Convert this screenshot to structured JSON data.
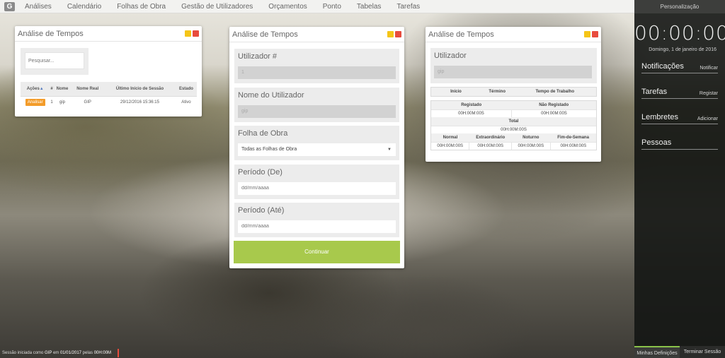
{
  "nav": {
    "logo": "G",
    "items": [
      "Análises",
      "Calendário",
      "Folhas de Obra",
      "Gestão de Utilizadores",
      "Orçamentos",
      "Ponto",
      "Tabelas",
      "Tarefas"
    ]
  },
  "sidebar": {
    "header": "Personalização",
    "clock": "00:00:00",
    "date": "Domingo, 1 de janeiro de 2016",
    "sections": [
      {
        "title": "Notificações",
        "action": "Notificar"
      },
      {
        "title": "Tarefas",
        "action": "Registar"
      },
      {
        "title": "Lembretes",
        "action": "Adicionar"
      },
      {
        "title": "Pessoas",
        "action": ""
      }
    ],
    "footer": {
      "settings": "Minhas Definições",
      "logout": "Terminar Sessão"
    }
  },
  "window1": {
    "title": "Análise de Tempos",
    "search_placeholder": "Pesquisar...",
    "columns": [
      "Ações",
      "#",
      "Nome",
      "Nome Real",
      "Último Início de Sessão",
      "Estado"
    ],
    "rows": [
      {
        "action": "Analisar",
        "id": "1",
        "name": "gip",
        "real_name": "GIP",
        "last_login": "29/12/2016 15:36:15",
        "state": "Ativo"
      }
    ]
  },
  "window2": {
    "title": "Análise de Tempos",
    "user_label": "Utilizador #",
    "user_value": "1",
    "username_label": "Nome do Utilizador",
    "username_value": "gip",
    "sheet_label": "Folha de Obra",
    "sheet_value": "Todas as Folhas de Obra",
    "from_label": "Período (De)",
    "from_placeholder": "dd/mm/aaaa",
    "to_label": "Período (Até)",
    "to_placeholder": "dd/mm/aaaa",
    "continue": "Continuar"
  },
  "window3": {
    "title": "Análise de Tempos",
    "user_label": "Utilizador",
    "user_value": "gip",
    "head": [
      "Início",
      "Término",
      "Tempo de Trabalho"
    ],
    "registered_label": "Registado",
    "not_registered_label": "Não Registado",
    "registered_value": "00H:00M:00S",
    "not_registered_value": "00H:00M:00S",
    "total_label": "Total",
    "total_value": "00H:00M:00S",
    "breakdown_labels": [
      "Normal",
      "Extraordinário",
      "Noturno",
      "Fim-de-Semana"
    ],
    "breakdown_values": [
      "00H:00M:00S",
      "00H:00M:00S",
      "00H:00M:00S",
      "00H:00M:00S"
    ]
  },
  "status": {
    "prefix": "Sessão iniciada como",
    "user": "GIP",
    "on": "em",
    "date": "01/01/2017",
    "for": "pelas",
    "time": "00H:00M"
  },
  "colors": {
    "accent_green": "#a8c94c",
    "minimize": "#f5c518",
    "close": "#e84c3d",
    "badge": "#f39c2a"
  }
}
